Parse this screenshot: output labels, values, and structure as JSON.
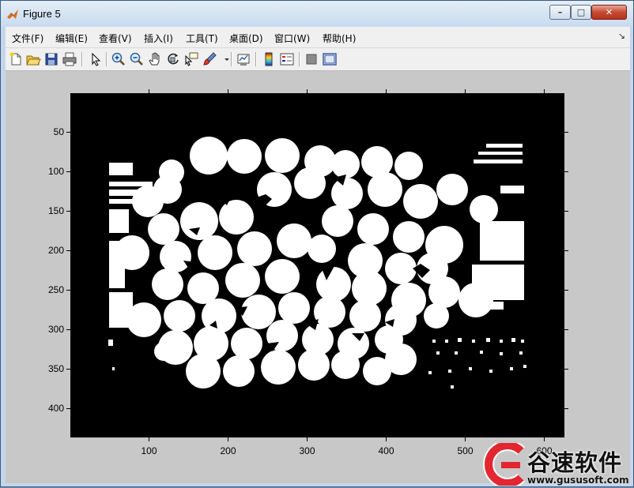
{
  "window": {
    "title": "Figure 5",
    "controls": {
      "minimize": "–",
      "maximize": "□",
      "close": "✕"
    }
  },
  "menubar": {
    "items": [
      "文件(F)",
      "编辑(E)",
      "查看(V)",
      "插入(I)",
      "工具(T)",
      "桌面(D)",
      "窗口(W)",
      "帮助(H)"
    ],
    "overflow": "↘"
  },
  "toolbar": {
    "tools": [
      "new-figure-icon",
      "open-file-icon",
      "save-icon",
      "print-icon",
      "edit-plot-arrow-icon",
      "zoom-in-icon",
      "zoom-out-icon",
      "pan-hand-icon",
      "rotate-3d-icon",
      "data-cursor-icon",
      "brush-icon",
      "link-plot-icon",
      "colorbar-icon",
      "legend-icon",
      "hide-plot-tools-icon",
      "show-plot-tools-icon"
    ]
  },
  "axes": {
    "y_ticks": [
      "50",
      "100",
      "150",
      "200",
      "250",
      "300",
      "350",
      "400"
    ],
    "x_ticks": [
      "100",
      "200",
      "300",
      "400",
      "500",
      "600"
    ]
  },
  "image": {
    "description_colors": {
      "background": "#000000",
      "foreground": "#ffffff"
    }
  },
  "watermark": {
    "name": "谷速软件",
    "url": "www.gususoft.com",
    "accent": "#e3262f"
  }
}
